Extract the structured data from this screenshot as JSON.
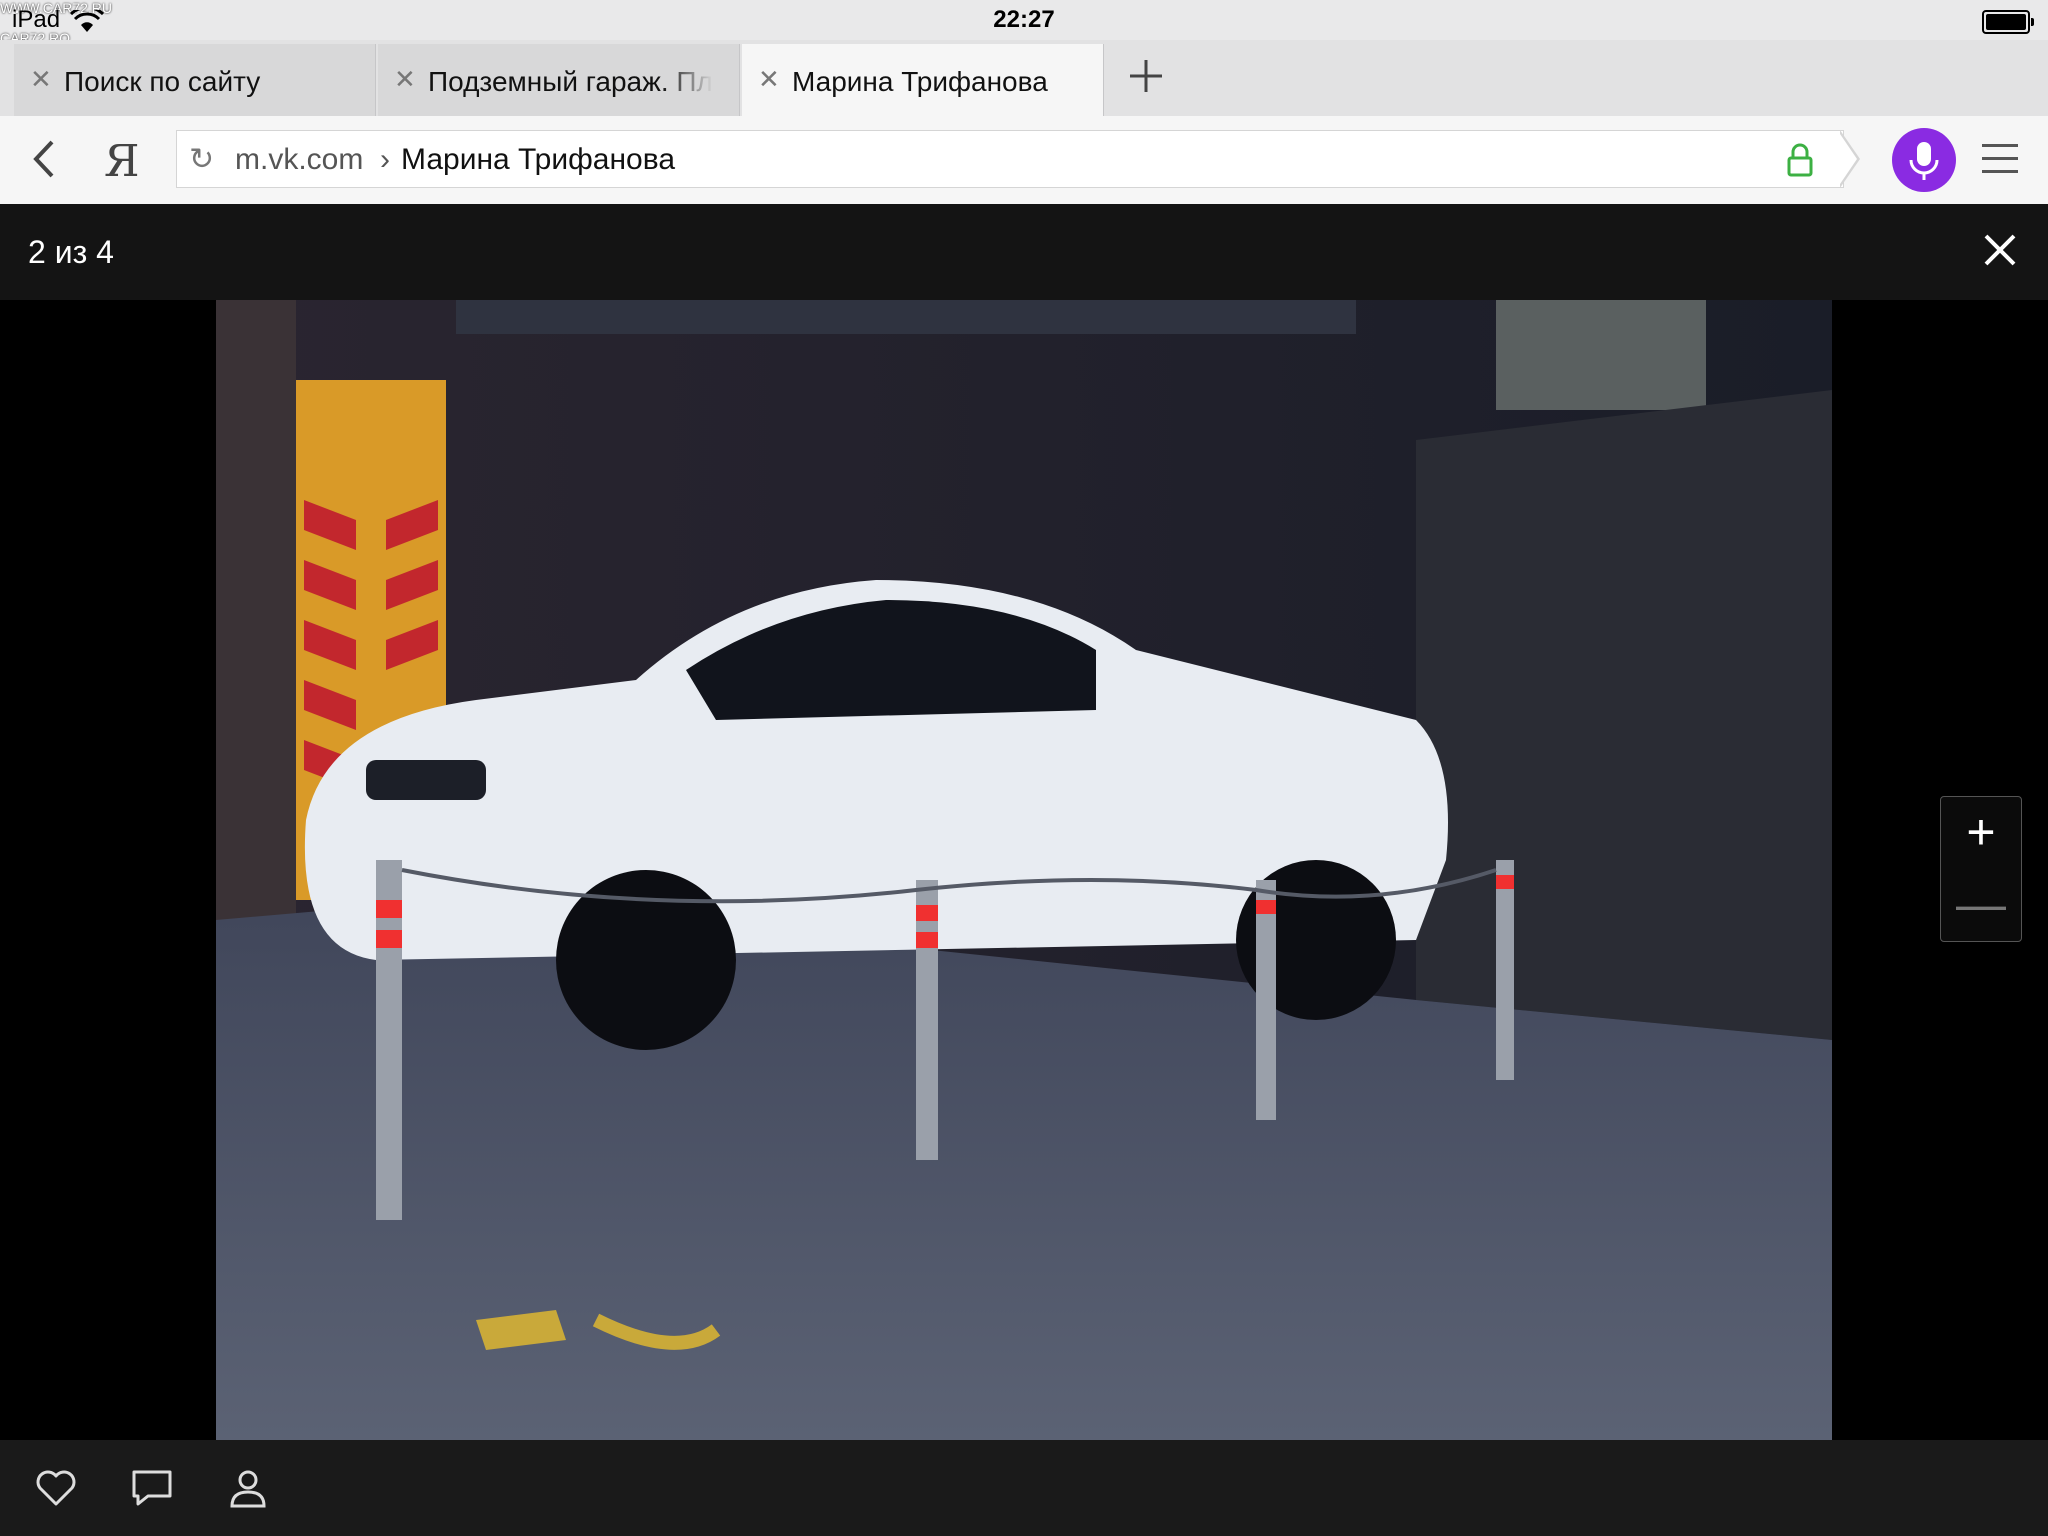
{
  "status_bar": {
    "device": "iPad",
    "time": "22:27",
    "watermark_top": "WWW.CAR72.RU",
    "watermark_bottom": "CAR72.RO"
  },
  "tabs": [
    {
      "label": "Поиск по сайту",
      "active": false
    },
    {
      "label": "Подземный гараж. Пл",
      "active": false
    },
    {
      "label": "Марина Трифанова",
      "active": true
    }
  ],
  "toolbar": {
    "logo": "Я",
    "url_domain": "m.vk.com",
    "url_separator": "›",
    "url_title": "Марина Трифанова"
  },
  "viewer": {
    "counter": "2 из 4",
    "zoom_in": "+",
    "zoom_out": "—"
  },
  "icons": {
    "back": "chevron-left-icon",
    "reload": "reload-icon",
    "lock": "lock-icon",
    "mic": "microphone-icon",
    "menu": "hamburger-menu-icon",
    "close": "close-icon",
    "like": "heart-icon",
    "comment": "comment-icon",
    "tag": "person-icon"
  },
  "colors": {
    "mic_accent": "#8a2be2",
    "lock_green": "#3cb043"
  }
}
